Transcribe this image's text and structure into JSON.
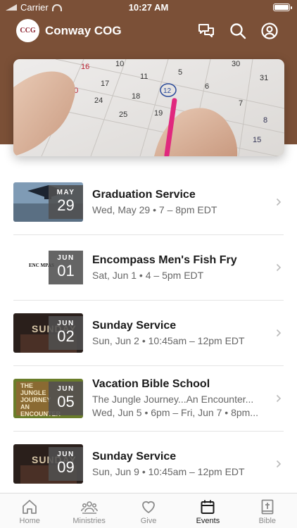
{
  "status_bar": {
    "carrier": "Carrier",
    "time": "10:27 AM"
  },
  "header": {
    "logo_text": "CCG",
    "title": "Conway COG",
    "icons": [
      "chat-icon",
      "search-icon",
      "profile-icon"
    ]
  },
  "hero": {
    "icon": "calendar-photo"
  },
  "events": [
    {
      "month": "MAY",
      "day": "29",
      "title": "Graduation Service",
      "line1": "Wed, May 29 • 7 – 8pm EDT",
      "line2": "",
      "thumb_label": ""
    },
    {
      "month": "JUN",
      "day": "01",
      "title": "Encompass Men's Fish Fry",
      "line1": "Sat, Jun 1 • 4 – 5pm EDT",
      "line2": "",
      "thumb_label": "ENC MPAS"
    },
    {
      "month": "JUN",
      "day": "02",
      "title": "Sunday Service",
      "line1": "Sun, Jun 2 • 10:45am – 12pm EDT",
      "line2": "",
      "thumb_label": "SUNDAY"
    },
    {
      "month": "JUN",
      "day": "05",
      "title": "Vacation Bible School",
      "line1": "The Jungle Journey...An Encounter...",
      "line2": "Wed, Jun 5 • 6pm – Fri, Jun 7 • 8pm...",
      "thumb_label": "THE JUNGLE JOURNEY AN ENCOUNTER WITH JESUS"
    },
    {
      "month": "JUN",
      "day": "09",
      "title": "Sunday Service",
      "line1": "Sun, Jun 9 • 10:45am – 12pm EDT",
      "line2": "",
      "thumb_label": "SUNDAY"
    }
  ],
  "tabs": [
    {
      "label": "Home",
      "icon": "home-icon",
      "active": false
    },
    {
      "label": "Ministries",
      "icon": "people-icon",
      "active": false
    },
    {
      "label": "Give",
      "icon": "heart-icon",
      "active": false
    },
    {
      "label": "Events",
      "icon": "calendar-icon",
      "active": true
    },
    {
      "label": "Bible",
      "icon": "bible-icon",
      "active": false
    }
  ],
  "colors": {
    "header_brown": "#7b5037",
    "tab_active": "#1a1a1a",
    "tab_inactive": "#8a8a8a"
  }
}
